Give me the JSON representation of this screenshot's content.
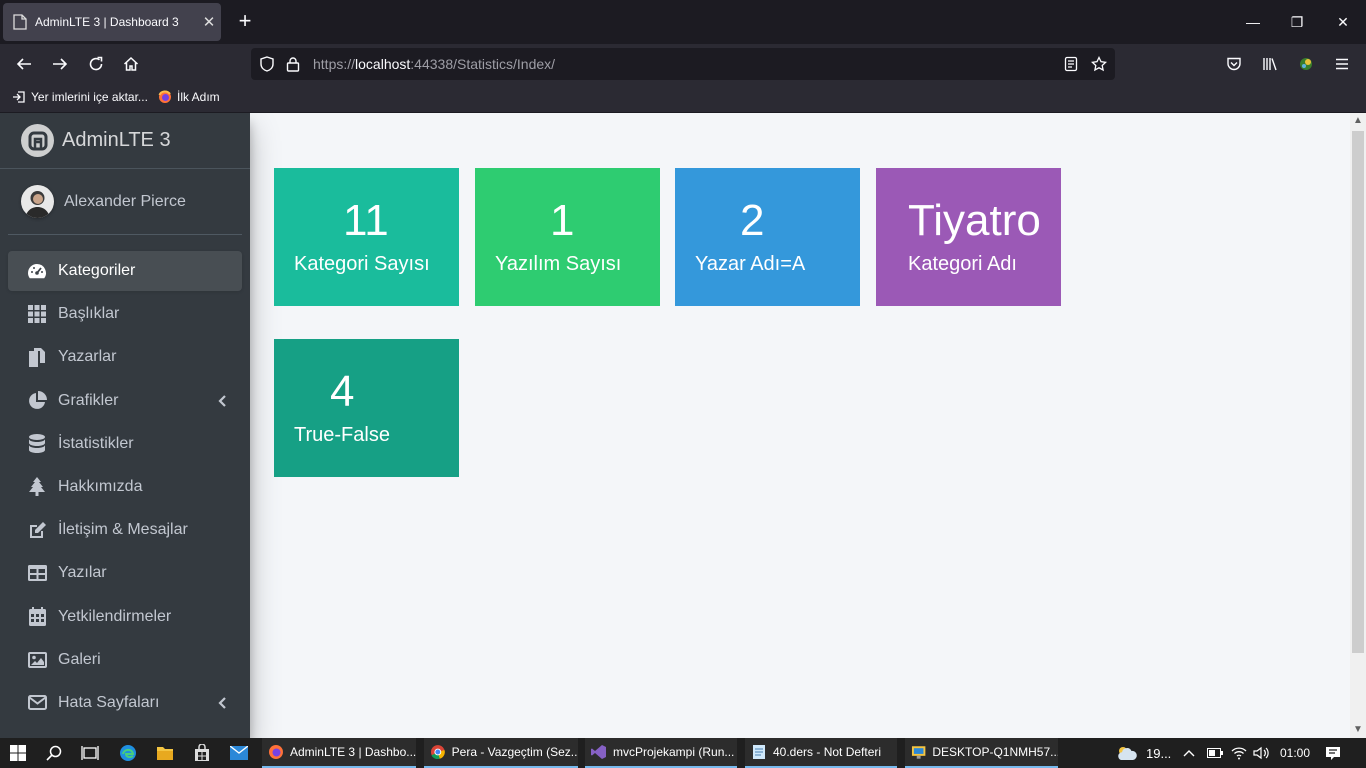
{
  "browser": {
    "tab_title": "AdminLTE 3 | Dashboard 3",
    "url_prefix": "https://",
    "url_host": "localhost",
    "url_rest": ":44338/Statistics/Index/",
    "bookmarks": [
      {
        "label": "Yer imlerini içe aktar..."
      },
      {
        "label": "İlk Adım"
      }
    ]
  },
  "sidebar": {
    "brand": "AdminLTE 3",
    "user_name": "Alexander Pierce",
    "items": [
      {
        "label": "Kategoriler",
        "icon": "tachometer-icon",
        "active": true
      },
      {
        "label": "Başlıklar",
        "icon": "grid-icon"
      },
      {
        "label": "Yazarlar",
        "icon": "copy-icon"
      },
      {
        "label": "Grafikler",
        "icon": "pie-chart-icon",
        "has_children": true
      },
      {
        "label": "İstatistikler",
        "icon": "database-icon"
      },
      {
        "label": "Hakkımızda",
        "icon": "tree-icon"
      },
      {
        "label": "İletişim & Mesajlar",
        "icon": "edit-icon"
      },
      {
        "label": "Yazılar",
        "icon": "table-icon"
      },
      {
        "label": "Yetkilendirmeler",
        "icon": "calendar-icon"
      },
      {
        "label": "Galeri",
        "icon": "image-icon"
      },
      {
        "label": "Hata Sayfaları",
        "icon": "envelope-icon",
        "has_children": true
      }
    ]
  },
  "stats": [
    {
      "value": "11",
      "label": "Kategori Sayısı",
      "color": "#1abc9c"
    },
    {
      "value": "1",
      "label": "Yazılım Sayısı",
      "color": "#2ecc71"
    },
    {
      "value": "2",
      "label": "Yazar Adı=A",
      "color": "#3498db"
    },
    {
      "value": "Tiyatro",
      "label": "Kategori Adı",
      "color": "#9b59b6"
    },
    {
      "value": "4",
      "label": "True-False",
      "color": "#16a085"
    }
  ],
  "taskbar": {
    "apps": [
      {
        "label": "AdminLTE 3 | Dashbo...",
        "icon": "firefox-icon"
      },
      {
        "label": "Pera - Vazgeçtim (Sez...",
        "icon": "chrome-icon"
      },
      {
        "label": "mvcProjekampi (Run...",
        "icon": "visual-studio-icon"
      },
      {
        "label": "40.ders - Not Defteri",
        "icon": "notepad-icon"
      },
      {
        "label": "DESKTOP-Q1NMH57....",
        "icon": "remote-desktop-icon"
      }
    ],
    "weather": "19...",
    "time": "01:00"
  }
}
